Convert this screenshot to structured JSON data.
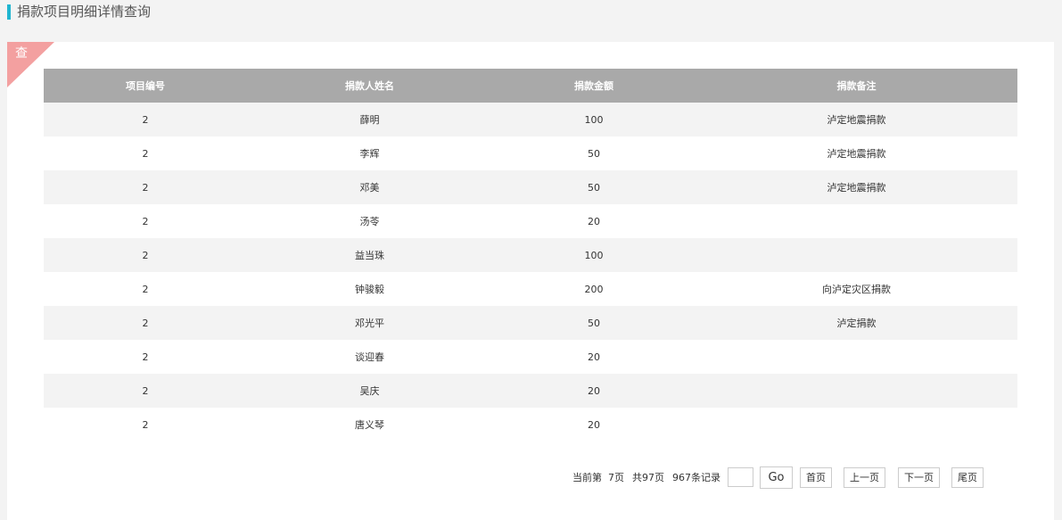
{
  "header": {
    "title": "捐款项目明细详情查询"
  },
  "panel": {
    "corner_label": "查"
  },
  "table": {
    "columns": [
      "项目编号",
      "捐款人姓名",
      "捐款金额",
      "捐款备注"
    ],
    "rows": [
      [
        "2",
        "薛明",
        "100",
        "泸定地震捐款"
      ],
      [
        "2",
        "李辉",
        "50",
        "泸定地震捐款"
      ],
      [
        "2",
        "邓美",
        "50",
        "泸定地震捐款"
      ],
      [
        "2",
        "汤苓",
        "20",
        ""
      ],
      [
        "2",
        "益当珠",
        "100",
        ""
      ],
      [
        "2",
        "钟骏毅",
        "200",
        "向泸定灾区捐款"
      ],
      [
        "2",
        "邓光平",
        "50",
        "泸定捐款"
      ],
      [
        "2",
        "谈迎春",
        "20",
        ""
      ],
      [
        "2",
        "吴庆",
        "20",
        ""
      ],
      [
        "2",
        "唐义琴",
        "20",
        ""
      ]
    ]
  },
  "pager": {
    "current_page": "当前第  7页",
    "total_pages": "共97页",
    "total_records": "967条记录",
    "page_input_value": "",
    "go_label": "Go",
    "first_label": "首页",
    "prev_label": "上一页",
    "next_label": "下一页",
    "last_label": "尾页"
  }
}
